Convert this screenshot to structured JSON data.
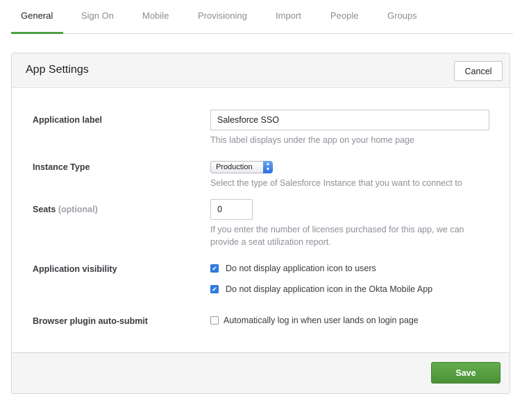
{
  "tabs": [
    {
      "label": "General",
      "active": true
    },
    {
      "label": "Sign On"
    },
    {
      "label": "Mobile"
    },
    {
      "label": "Provisioning"
    },
    {
      "label": "Import"
    },
    {
      "label": "People"
    },
    {
      "label": "Groups"
    }
  ],
  "panel": {
    "title": "App Settings",
    "cancel_label": "Cancel",
    "save_label": "Save"
  },
  "fields": {
    "app_label": {
      "label": "Application label",
      "value": "Salesforce SSO",
      "help": "This label displays under the app on your home page"
    },
    "instance_type": {
      "label": "Instance Type",
      "selected": "Production",
      "help": "Select the type of Salesforce Instance that you want to connect to"
    },
    "seats": {
      "label": "Seats",
      "optional": "(optional)",
      "value": "0",
      "help_line1": "If you enter the number of licenses purchased for this app, we can",
      "help_line2": "provide a seat utilization report."
    },
    "visibility": {
      "label": "Application visibility",
      "option1": {
        "label": "Do not display application icon to users",
        "checked": true
      },
      "option2": {
        "label": "Do not display application icon in the Okta Mobile App",
        "checked": true
      }
    },
    "auto_submit": {
      "label": "Browser plugin auto-submit",
      "option": {
        "label": "Automatically log in when user lands on login page",
        "checked": false
      }
    }
  },
  "colors": {
    "accent_green": "#4f9f45",
    "checkbox_blue": "#2f7ee6"
  }
}
